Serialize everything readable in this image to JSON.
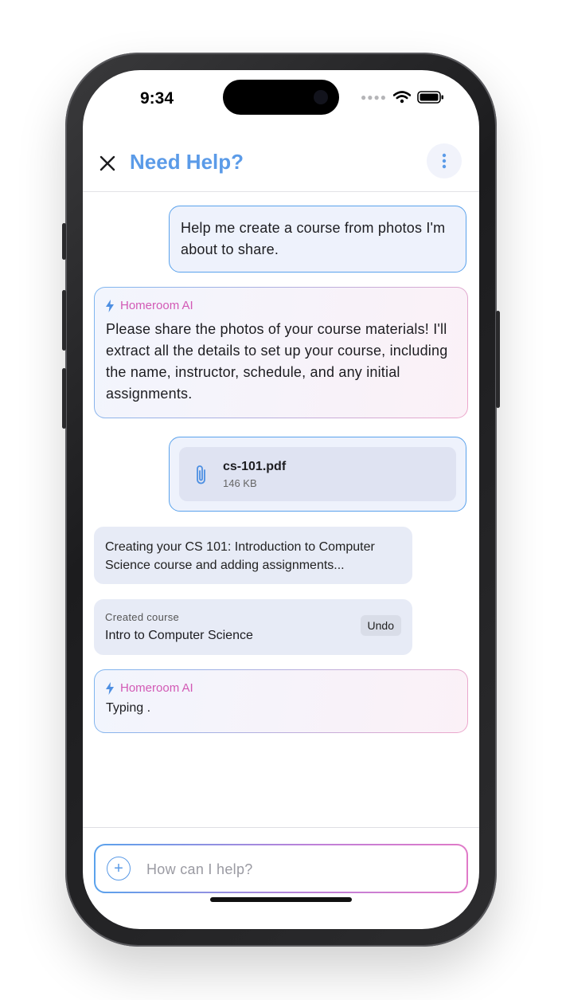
{
  "status_bar": {
    "time": "9:34"
  },
  "header": {
    "title": "Need Help?"
  },
  "messages": {
    "user_1": "Help me create a course from photos I'm about to share.",
    "ai_1": {
      "label": "Homeroom AI",
      "text": "Please share the photos of your course materials! I'll extract all the details to set up your course, including the name, instructor, schedule, and any initial assignments."
    },
    "file": {
      "name": "cs-101.pdf",
      "size": "146 KB"
    },
    "system_1": "Creating your CS 101: Introduction to Computer Science course and adding assignments...",
    "created": {
      "label": "Created course",
      "name": "Intro to Computer Science",
      "undo": "Undo"
    },
    "ai_2": {
      "label": "Homeroom AI",
      "text": "Typing ."
    }
  },
  "input": {
    "placeholder": "How can I help?",
    "value": ""
  },
  "colors": {
    "accent_blue": "#5b9be8",
    "ai_pink": "#d259b5"
  }
}
